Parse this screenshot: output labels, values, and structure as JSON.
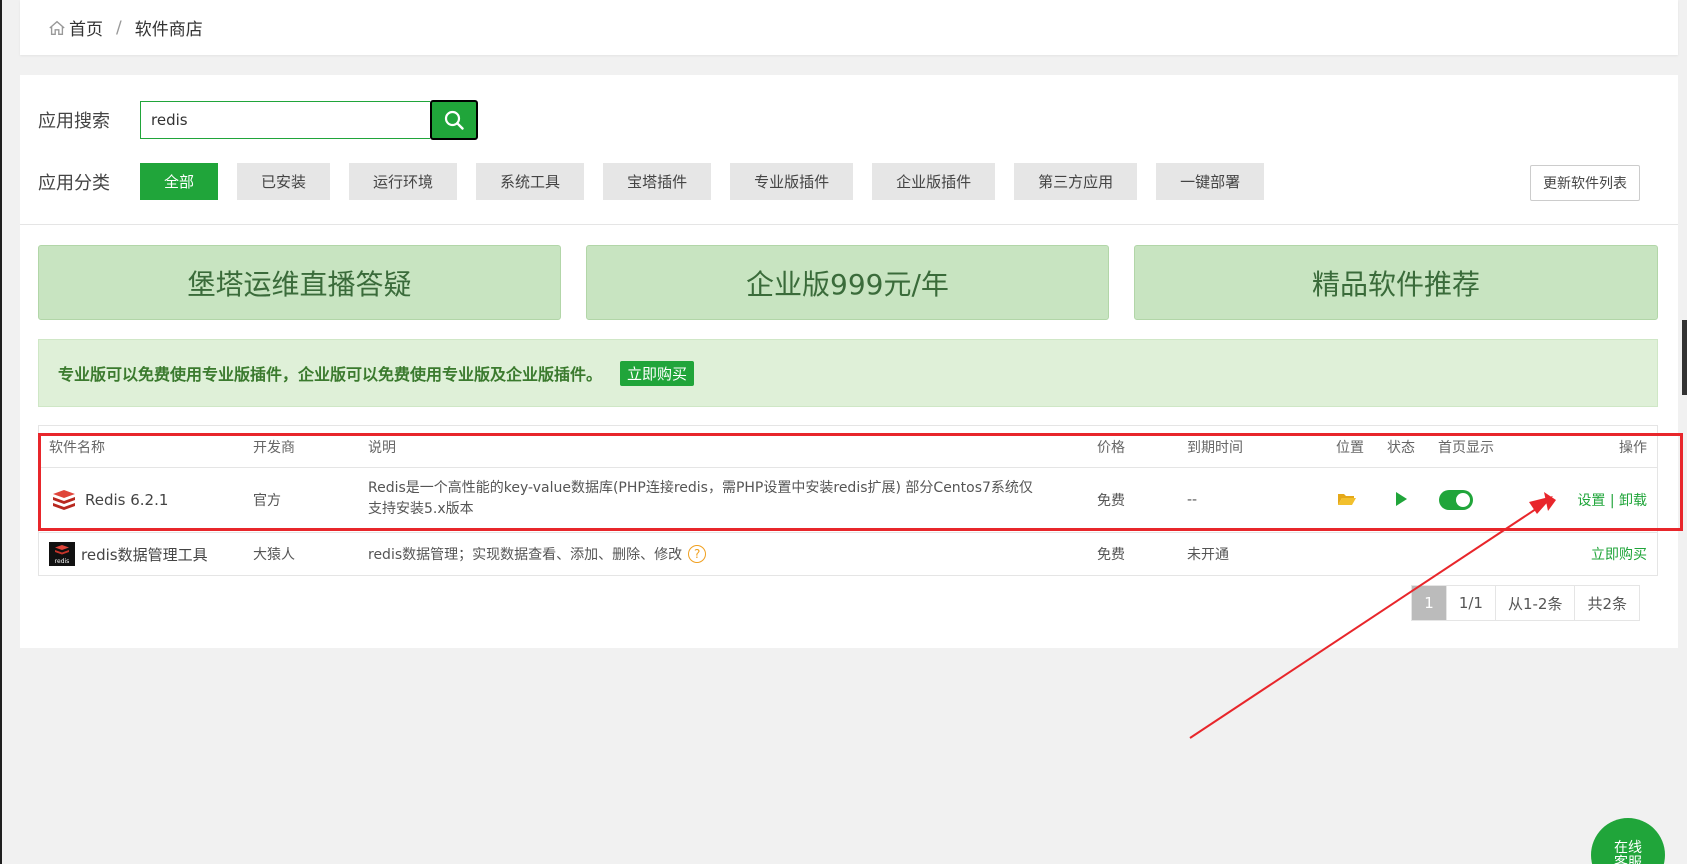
{
  "breadcrumb": {
    "home": "首页",
    "separator": "/",
    "current": "软件商店"
  },
  "search": {
    "label": "应用搜索",
    "value": "redis"
  },
  "categories": {
    "label": "应用分类",
    "items": [
      "全部",
      "已安装",
      "运行环境",
      "系统工具",
      "宝塔插件",
      "专业版插件",
      "企业版插件",
      "第三方应用",
      "一键部署"
    ],
    "active": "全部"
  },
  "update_button": "更新软件列表",
  "banners": [
    "堡塔运维直播答疑",
    "企业版999元/年",
    "精品软件推荐"
  ],
  "notice": {
    "text": "专业版可以免费使用专业版插件，企业版可以免费使用专业版及企业版插件。",
    "button": "立即购买"
  },
  "table": {
    "headers": [
      "软件名称",
      "开发商",
      "说明",
      "价格",
      "到期时间",
      "位置",
      "状态",
      "首页显示",
      "操作"
    ],
    "rows": [
      {
        "name": "Redis 6.2.1",
        "developer": "官方",
        "description_line1": "Redis是一个高性能的key-value数据库(PHP连接redis，需PHP设置中安装redis扩展) 部分Centos7系统仅",
        "description_line2": "支持安装5.x版本",
        "price": "免费",
        "expiry": "--",
        "homepage_display": true,
        "action_settings": "设置",
        "action_sep": "|",
        "action_uninstall": "卸载"
      },
      {
        "name": "redis数据管理工具",
        "developer": "大猿人",
        "description": "redis数据管理；实现数据查看、添加、删除、修改",
        "help": "?",
        "price": "免费",
        "expiry": "未开通",
        "action_buy": "立即购买"
      }
    ]
  },
  "pagination": {
    "current": "1",
    "pages": "1/1",
    "range": "从1-2条",
    "total": "共2条"
  },
  "online_button": {
    "line1": "在线",
    "line2": "客服"
  },
  "colors": {
    "accent": "#20a53a",
    "annotation": "#e8262b",
    "banner_bg": "#c8e4c1",
    "notice_bg": "#dff0d8"
  }
}
